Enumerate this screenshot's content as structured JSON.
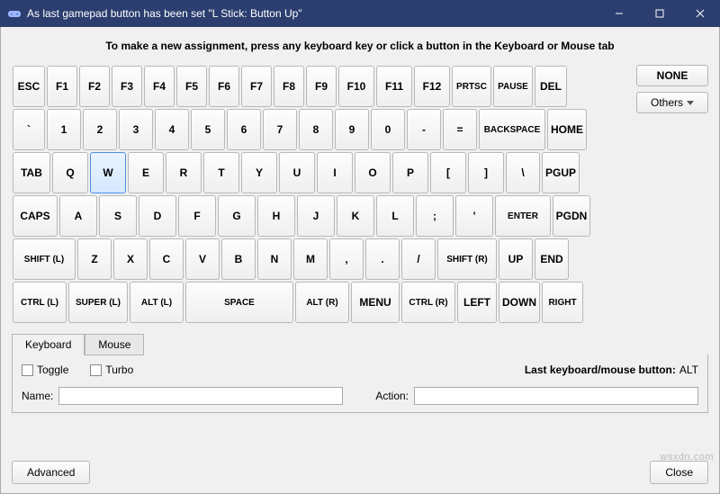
{
  "window": {
    "title": "As last gamepad button has been set \"L Stick: Button Up\""
  },
  "hint": "To make a new assignment, press any keyboard key or click a button in the Keyboard or Mouse tab",
  "side": {
    "none": "NONE",
    "others": "Others"
  },
  "keyboard": {
    "selected": "W",
    "row0": [
      "ESC",
      "F1",
      "F2",
      "F3",
      "F4",
      "F5",
      "F6",
      "F7",
      "F8",
      "F9",
      "F10",
      "F11",
      "F12",
      "PRTSC",
      "PAUSE",
      "DEL"
    ],
    "row1": [
      "`",
      "1",
      "2",
      "3",
      "4",
      "5",
      "6",
      "7",
      "8",
      "9",
      "0",
      "-",
      "=",
      "BACKSPACE",
      "HOME"
    ],
    "row2": [
      "TAB",
      "Q",
      "W",
      "E",
      "R",
      "T",
      "Y",
      "U",
      "I",
      "O",
      "P",
      "[",
      "]",
      "\\",
      "PGUP"
    ],
    "row3": [
      "CAPS",
      "A",
      "S",
      "D",
      "F",
      "G",
      "H",
      "J",
      "K",
      "L",
      ";",
      "'",
      "ENTER",
      "PGDN"
    ],
    "row4": [
      "SHIFT (L)",
      "Z",
      "X",
      "C",
      "V",
      "B",
      "N",
      "M",
      ",",
      ".",
      "/",
      "SHIFT (R)",
      "UP",
      "END"
    ],
    "row5": [
      "CTRL (L)",
      "SUPER (L)",
      "ALT (L)",
      "SPACE",
      "ALT (R)",
      "MENU",
      "CTRL (R)",
      "LEFT",
      "DOWN",
      "RIGHT"
    ]
  },
  "tabs": {
    "keyboard": "Keyboard",
    "mouse": "Mouse"
  },
  "options": {
    "toggle": "Toggle",
    "turbo": "Turbo",
    "last_label": "Last keyboard/mouse button:",
    "last_value": "ALT",
    "name_label": "Name:",
    "action_label": "Action:",
    "name_value": "",
    "action_value": ""
  },
  "footer": {
    "advanced": "Advanced",
    "close": "Close"
  },
  "watermark": "wsxdn.com"
}
